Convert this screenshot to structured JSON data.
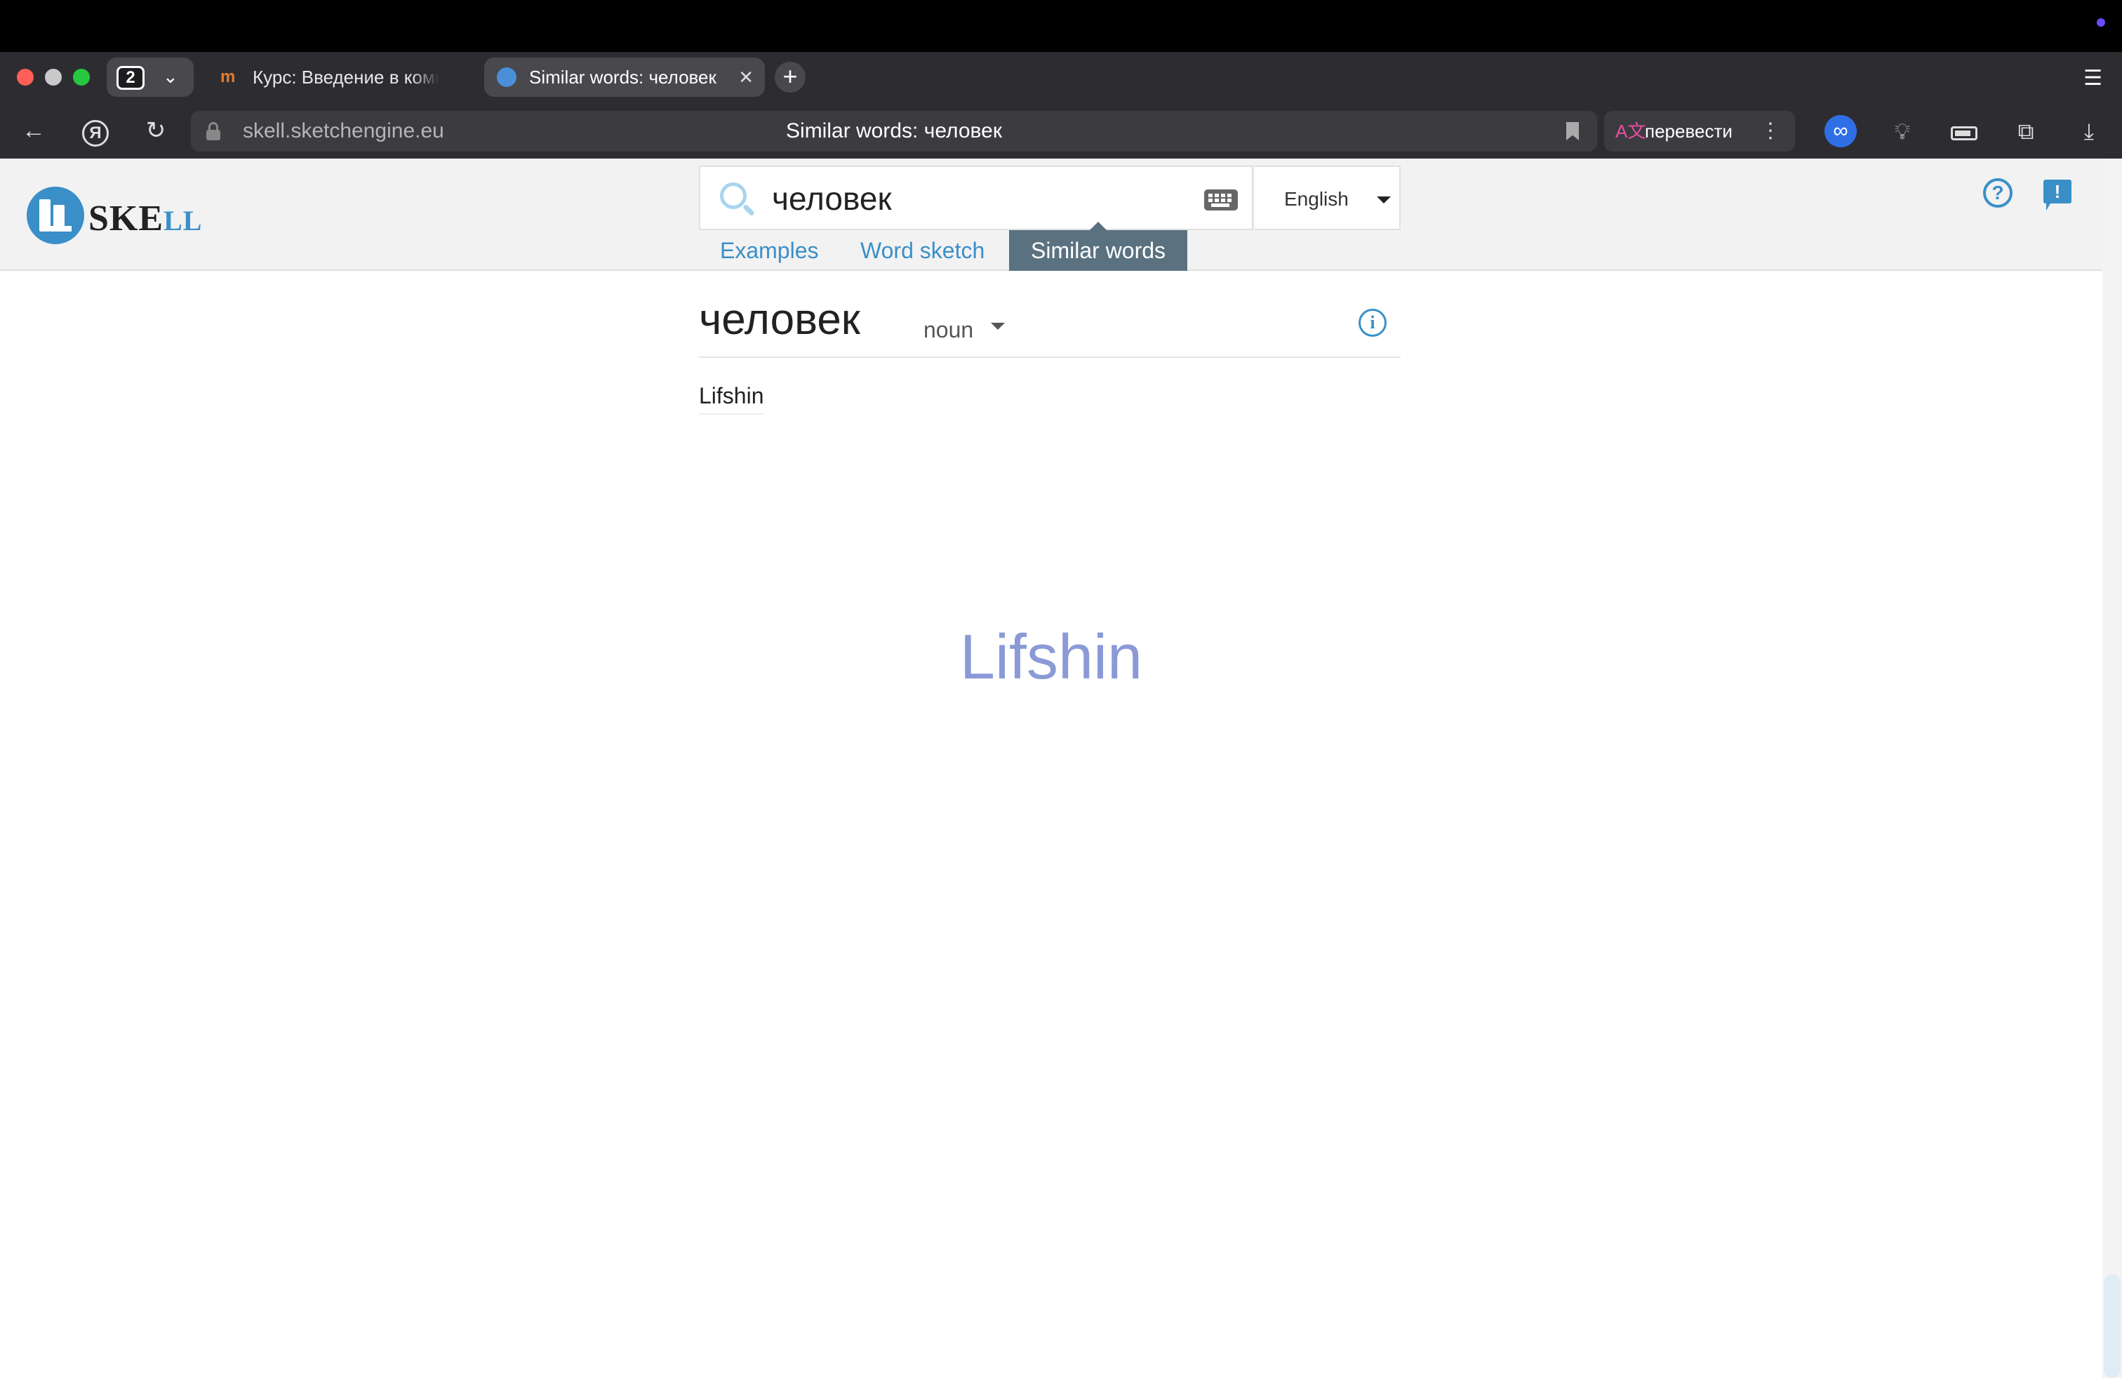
{
  "browser": {
    "tab_count": "2",
    "tabs": [
      {
        "title": "Курс: Введение в компьютерную лингвистику",
        "favicon": "m",
        "active": false
      },
      {
        "title": "Similar words: человек",
        "active": true
      }
    ],
    "new_tab_label": "+",
    "url": "skell.sketchengine.eu",
    "page_title": "Similar words: человек",
    "translate_label": "перевести",
    "icons": [
      "back-arrow-icon",
      "yandex-icon",
      "reload-icon",
      "lock-icon",
      "bookmark-icon",
      "translate-icon",
      "infinity-icon",
      "bulb-icon",
      "battery-icon",
      "translate-ext-icon",
      "download-icon",
      "menu-icon"
    ]
  },
  "header": {
    "logo_main": "SKE",
    "logo_suffix": "LL",
    "search_value": "человек",
    "language": "English",
    "tabs": [
      {
        "label": "Examples",
        "active": false
      },
      {
        "label": "Word sketch",
        "active": false
      },
      {
        "label": "Similar words",
        "active": true
      }
    ],
    "accent_color": "#3a8fc8"
  },
  "main": {
    "headword": "человек",
    "pos": "noun",
    "results": [
      {
        "word": "Lifshin"
      }
    ],
    "cloud": [
      {
        "word": "Lifshin",
        "color": "#8b9ad6"
      }
    ]
  }
}
